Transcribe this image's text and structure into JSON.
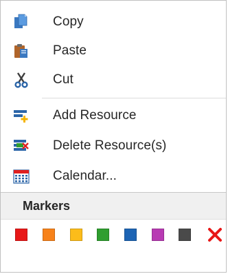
{
  "menu": {
    "copy_label": "Copy",
    "paste_label": "Paste",
    "cut_label": "Cut",
    "add_resource_label": "Add Resource",
    "delete_resource_label": "Delete Resource(s)",
    "calendar_label": "Calendar..."
  },
  "markers": {
    "title": "Markers",
    "colors": [
      "#e81818",
      "#f7821a",
      "#fcbc1a",
      "#2f9e2f",
      "#1d64b4",
      "#b83ab3",
      "#4a4a4a"
    ],
    "clear_icon": "red-x-icon"
  },
  "icons": {
    "copy": "copy-icon",
    "paste": "paste-icon",
    "cut": "scissors-icon",
    "add_resource": "add-resource-icon",
    "delete_resource": "delete-resource-icon",
    "calendar": "calendar-icon"
  }
}
